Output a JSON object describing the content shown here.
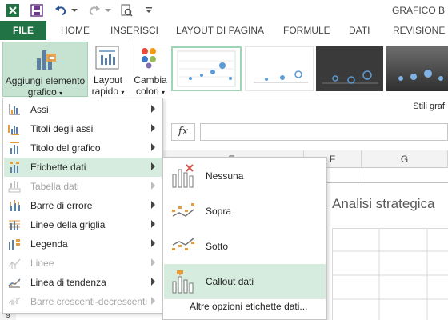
{
  "title_bar": {
    "app_title": "GRAFICO B"
  },
  "ribbon_tabs": [
    "FILE",
    "HOME",
    "INSERISCI",
    "LAYOUT DI PAGINA",
    "FORMULE",
    "DATI",
    "REVISIONE"
  ],
  "ribbon": {
    "add_element": {
      "line1": "Aggiungi elemento",
      "line2": "grafico"
    },
    "quick_layout": {
      "line1": "Layout",
      "line2": "rapido"
    },
    "change_colors": {
      "line1": "Cambia",
      "line2": "colori"
    },
    "styles_group_label": "Stili graf"
  },
  "formula_bar": {
    "fx": "fx"
  },
  "columns": [
    "E",
    "F",
    "G"
  ],
  "row_header": "9",
  "chart": {
    "title": "Analisi strategica"
  },
  "menu": {
    "items": [
      {
        "label": "Assi",
        "enabled": true,
        "icon": "axes-icon"
      },
      {
        "label": "Titoli degli assi",
        "enabled": true,
        "icon": "axis-titles-icon"
      },
      {
        "label": "Titolo del grafico",
        "enabled": true,
        "icon": "chart-title-icon"
      },
      {
        "label": "Etichette dati",
        "enabled": true,
        "icon": "data-labels-icon",
        "highlighted": true
      },
      {
        "label": "Tabella dati",
        "enabled": false,
        "icon": "data-table-icon"
      },
      {
        "label": "Barre di errore",
        "enabled": true,
        "icon": "error-bars-icon"
      },
      {
        "label": "Linee della griglia",
        "enabled": true,
        "icon": "gridlines-icon"
      },
      {
        "label": "Legenda",
        "enabled": true,
        "icon": "legend-icon"
      },
      {
        "label": "Linee",
        "enabled": false,
        "icon": "lines-icon"
      },
      {
        "label": "Linea di tendenza",
        "enabled": true,
        "icon": "trendline-icon"
      },
      {
        "label": "Barre crescenti-decrescenti",
        "enabled": false,
        "icon": "up-down-bars-icon"
      }
    ]
  },
  "submenu": {
    "items": [
      {
        "label": "Nessuna",
        "icon": "no-labels-icon"
      },
      {
        "label": "Sopra",
        "icon": "labels-above-icon"
      },
      {
        "label": "Sotto",
        "icon": "labels-below-icon"
      },
      {
        "label": "Callout dati",
        "icon": "data-callout-icon",
        "highlighted": true
      }
    ],
    "more_options": "Altre opzioni etichette dati..."
  },
  "colors": {
    "accent_green": "#217346",
    "hover_green": "#d5ecdf",
    "button_pressed": "#c6e3d2"
  }
}
